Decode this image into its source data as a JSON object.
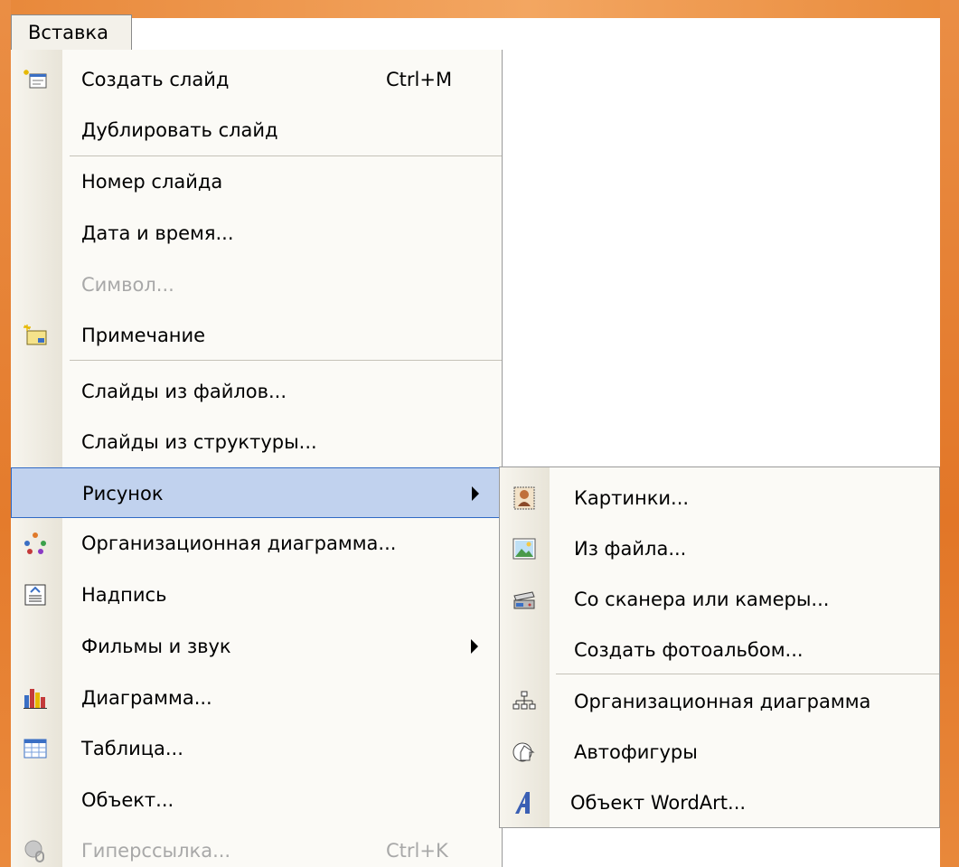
{
  "menubar": {
    "label": "Вставка"
  },
  "menu": {
    "items": [
      {
        "label": "Создать слайд",
        "shortcut": "Ctrl+M",
        "icon": "new-slide-icon",
        "enabled": true
      },
      {
        "label": "Дублировать слайд",
        "enabled": true
      },
      {
        "label": "Номер слайда",
        "enabled": true
      },
      {
        "label": "Дата и время...",
        "enabled": true
      },
      {
        "label": "Символ...",
        "enabled": false
      },
      {
        "label": "Примечание",
        "icon": "comment-icon",
        "enabled": true
      },
      {
        "label": "Слайды из файлов...",
        "enabled": true
      },
      {
        "label": "Слайды из структуры...",
        "enabled": true
      },
      {
        "label": "Рисунок",
        "submenu": true,
        "highlighted": true,
        "enabled": true
      },
      {
        "label": "Организационная диаграмма...",
        "icon": "org-chart-icon",
        "enabled": true
      },
      {
        "label": "Надпись",
        "icon": "textbox-icon",
        "enabled": true
      },
      {
        "label": "Фильмы и звук",
        "submenu": true,
        "enabled": true
      },
      {
        "label": "Диаграмма...",
        "icon": "chart-icon",
        "enabled": true
      },
      {
        "label": "Таблица...",
        "icon": "table-icon",
        "enabled": true
      },
      {
        "label": "Объект...",
        "enabled": true
      },
      {
        "label": "Гиперссылка...",
        "shortcut": "Ctrl+K",
        "icon": "hyperlink-icon",
        "enabled": false
      }
    ]
  },
  "submenu": {
    "items": [
      {
        "label": "Картинки...",
        "icon": "clipart-icon"
      },
      {
        "label": "Из файла...",
        "icon": "picture-from-file-icon"
      },
      {
        "label": "Со сканера или камеры...",
        "icon": "scanner-icon"
      },
      {
        "label": "Создать фотоальбом..."
      },
      {
        "label": "Организационная диаграмма",
        "icon": "org-chart-small-icon"
      },
      {
        "label": "Автофигуры",
        "icon": "autoshapes-icon"
      },
      {
        "label": "Объект WordArt...",
        "icon": "wordart-icon"
      }
    ]
  },
  "colors": {
    "frame": "#e8883a",
    "highlight": "#c1d2ee",
    "highlight_border": "#316ac5",
    "disabled_text": "#a8a8a8"
  }
}
